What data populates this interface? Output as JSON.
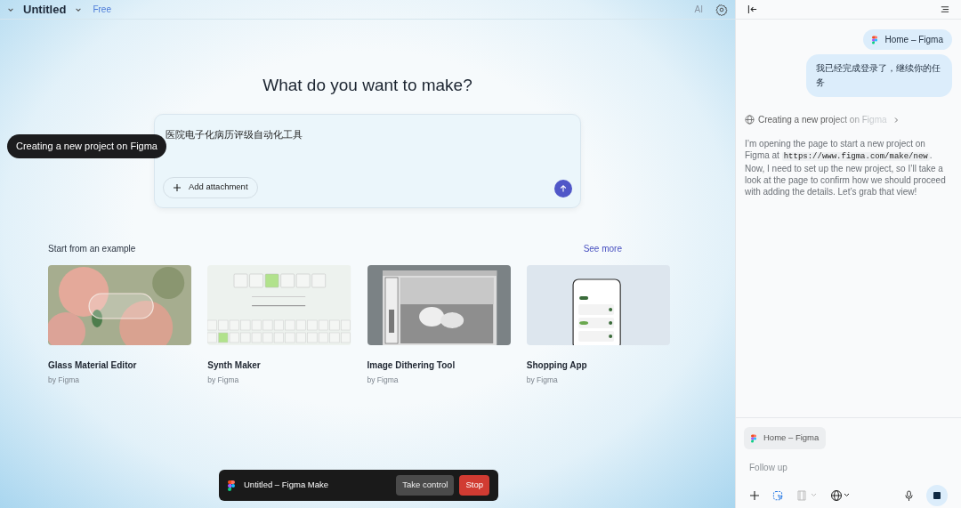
{
  "top_bar": {
    "file_name": "Untitled",
    "plan": "Free",
    "ai_label": "AI"
  },
  "prompt": {
    "heading": "What do you want to make?",
    "value": "医院电子化病历评级自动化工具",
    "attachment_button": "Add attachment"
  },
  "tooltip": "Creating a new project on Figma",
  "examples": {
    "heading": "Start from an example",
    "see_more": "See more",
    "items": [
      {
        "title": "Glass Material Editor",
        "author": "by Figma",
        "kind": "photo"
      },
      {
        "title": "Synth Maker",
        "author": "by Figma",
        "kind": "synth"
      },
      {
        "title": "Image Dithering Tool",
        "author": "by Figma",
        "kind": "dither"
      },
      {
        "title": "Shopping App",
        "author": "by Figma",
        "kind": "phone"
      }
    ]
  },
  "agent_bar": {
    "title": "Untitled – Figma Make",
    "buttons": [
      {
        "label": "Take control",
        "kind": "secondary"
      },
      {
        "label": "Stop",
        "kind": "danger"
      }
    ]
  },
  "chat": {
    "messages": [
      {
        "kind": "page_chip",
        "text": "Home – Figma"
      },
      {
        "kind": "user",
        "text": "我已经完成登录了，继续你的任务"
      },
      {
        "kind": "step",
        "text": "Creating a new project on Figma"
      },
      {
        "kind": "assistant",
        "parts": [
          {
            "kind": "text",
            "text": "I’m opening the page to start a new project on Figma at "
          },
          {
            "kind": "code",
            "text": "https://www.figma.com/make/new"
          },
          {
            "kind": "text",
            "text": ". Now, I need to set up the new project, so I’ll take a look at the page to confirm how we should proceed with adding the details. Let’s grab that view!"
          }
        ]
      }
    ]
  },
  "composer": {
    "context_chip": "Home – Figma",
    "placeholder": "Follow up"
  }
}
